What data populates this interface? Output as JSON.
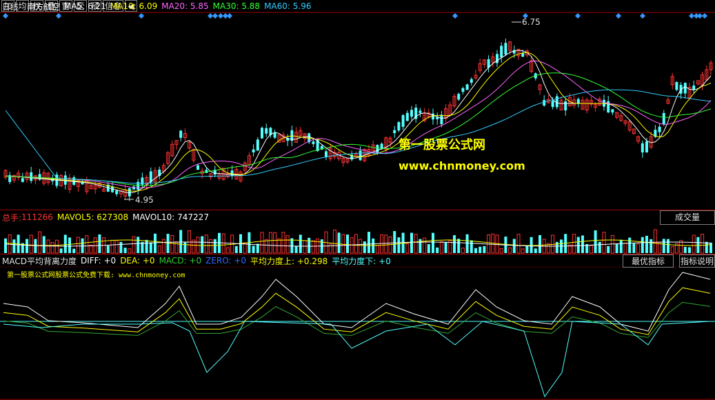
{
  "header": {
    "period": "日线",
    "stock_name": "南方航空",
    "ma": [
      {
        "label": "MA5: 6.21",
        "color": "#ffffff"
      },
      {
        "label": "MA10: 6.09",
        "color": "#ffff00"
      },
      {
        "label": "MA20: 5.85",
        "color": "#ff66ff"
      },
      {
        "label": "MA30: 5.88",
        "color": "#33ff33"
      },
      {
        "label": "MA60: 5.96",
        "color": "#33ccff"
      }
    ]
  },
  "toolbar": [
    "加",
    "均",
    "权",
    "叠",
    "窗",
    "区",
    "预",
    "信息",
    "◀"
  ],
  "price_chart": {
    "high_label": "6.75",
    "low_label": "4.95",
    "watermark_cn": "第一股票公式网",
    "watermark_url": "www.chnmoney.com"
  },
  "volume": {
    "total_label": "总手: ",
    "total_value": "111266",
    "mavol5": "MAVOL5: 627308",
    "mavol10": "MAVOL10: 747227",
    "button": "成交量"
  },
  "indicator": {
    "title": "MACD平均背离力度",
    "diff": "DIFF: +0",
    "dea": "DEA: +0",
    "macd": "MACD: +0",
    "zero": "ZERO: +0",
    "up": "平均力度上: +0.298",
    "down": "平均力度下: +0",
    "subtext": "第一股票公式网股票公式免费下载: www.chnmoney.com",
    "btn_best": "最优指标",
    "btn_help": "指标说明"
  },
  "colors": {
    "up": "#ff3232",
    "down": "#54ffff",
    "yellow": "#ffff00",
    "white": "#ffffff",
    "magenta": "#ff66ff",
    "green": "#33ff33",
    "cyan": "#33ccff",
    "axis_red": "#a00000"
  }
}
